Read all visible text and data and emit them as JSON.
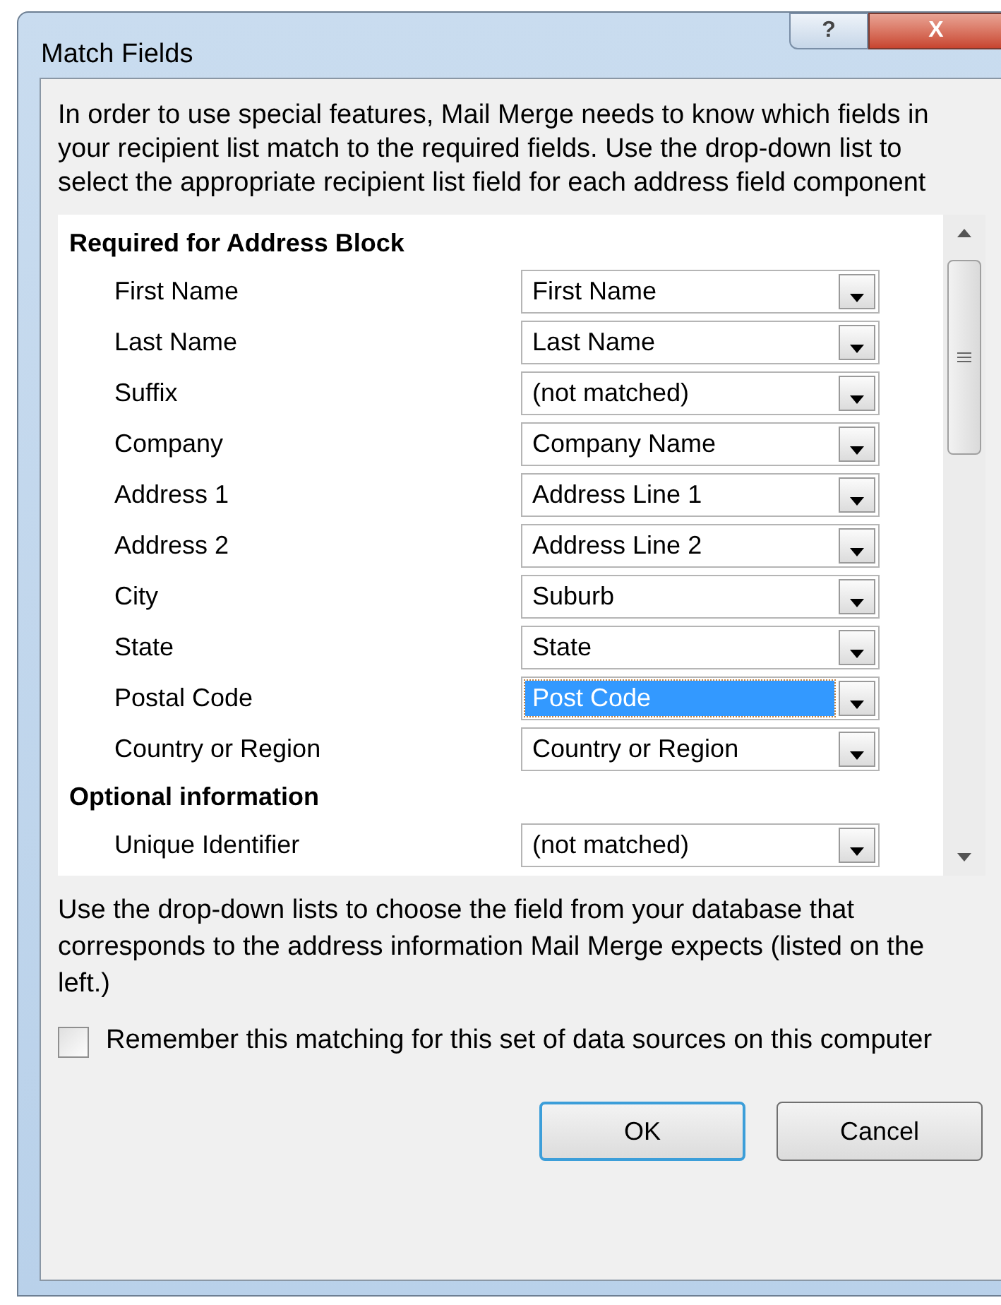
{
  "window": {
    "title": "Match Fields",
    "help_button": "?",
    "close_button": "X"
  },
  "intro": "In order to use special features, Mail Merge needs to know which fields in your recipient list match to the required fields. Use the drop-down list to select the appropriate recipient list field for each address field component",
  "sections": [
    {
      "title": "Required for Address Block",
      "fields": [
        {
          "label": "First Name",
          "value": "First Name",
          "selected": false
        },
        {
          "label": "Last Name",
          "value": "Last Name",
          "selected": false
        },
        {
          "label": "Suffix",
          "value": "(not matched)",
          "selected": false
        },
        {
          "label": "Company",
          "value": "Company Name",
          "selected": false
        },
        {
          "label": "Address 1",
          "value": "Address Line 1",
          "selected": false
        },
        {
          "label": "Address 2",
          "value": "Address Line 2",
          "selected": false
        },
        {
          "label": "City",
          "value": "Suburb",
          "selected": false
        },
        {
          "label": "State",
          "value": "State",
          "selected": false
        },
        {
          "label": "Postal Code",
          "value": "Post Code",
          "selected": true
        },
        {
          "label": "Country or Region",
          "value": "Country or Region",
          "selected": false
        }
      ]
    },
    {
      "title": "Optional information",
      "fields": [
        {
          "label": "Unique Identifier",
          "value": "(not matched)",
          "selected": false
        }
      ]
    }
  ],
  "hint": "Use the drop-down lists to choose the field from your database that corresponds to the address information Mail Merge expects (listed on the left.)",
  "remember": {
    "label": "Remember this matching for this set of data sources on this computer",
    "checked": false
  },
  "buttons": [
    {
      "label": "OK",
      "default": true
    },
    {
      "label": "Cancel",
      "default": false
    }
  ]
}
